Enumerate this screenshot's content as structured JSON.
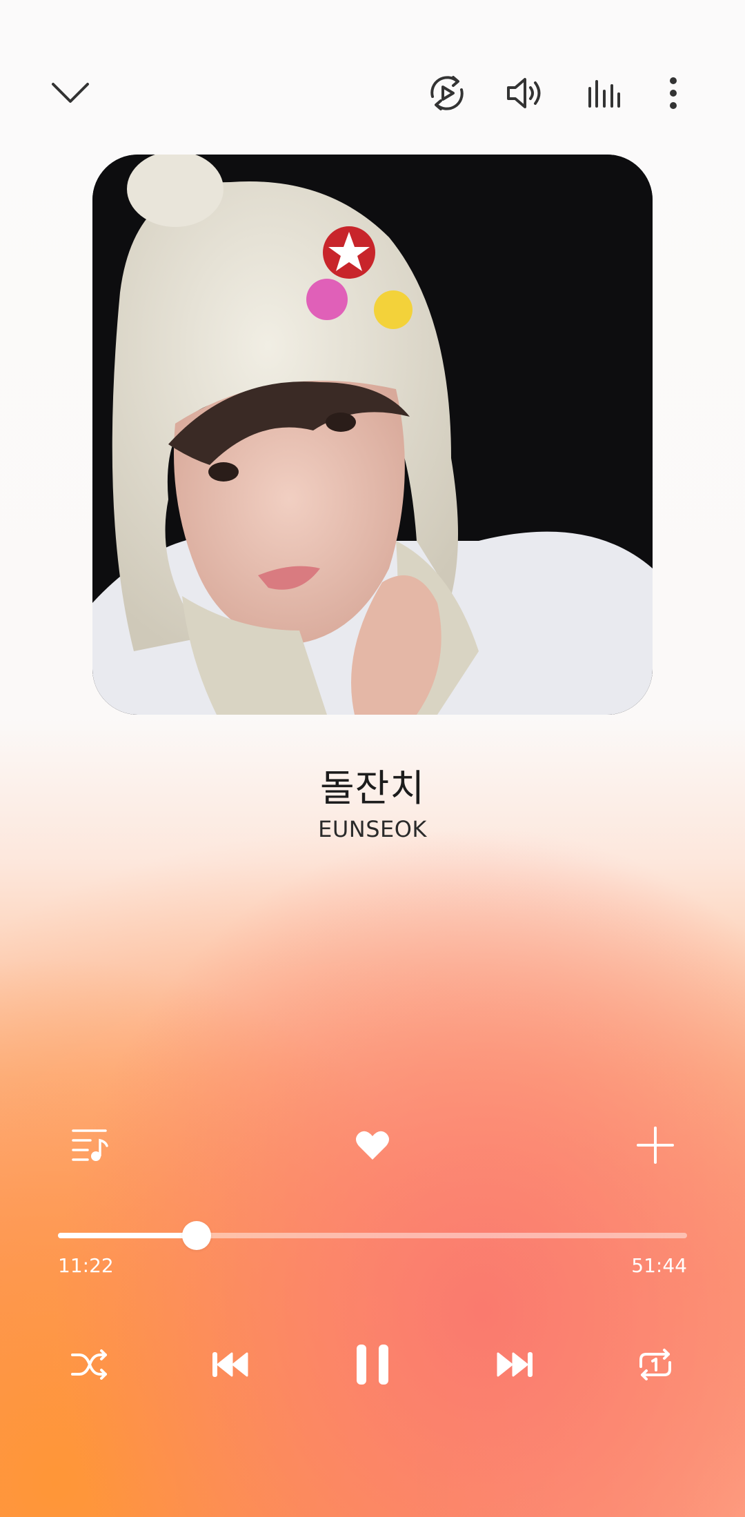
{
  "header": {
    "collapse_icon": "chevron-down-icon",
    "actions": [
      "video-play-icon",
      "volume-icon",
      "equalizer-icon",
      "more-vert-icon"
    ]
  },
  "album_art": {
    "description_icon": "album-art"
  },
  "track": {
    "title": "돌잔치",
    "artist": "EUNSEOK"
  },
  "actions": {
    "queue_icon": "playlist-music-icon",
    "favorite_icon": "heart-icon",
    "add_icon": "plus-icon"
  },
  "progress": {
    "elapsed": "11:22",
    "duration": "51:44",
    "fraction": 0.22
  },
  "controls": [
    "shuffle-icon",
    "previous-icon",
    "pause-icon",
    "next-icon",
    "repeat-one-icon"
  ],
  "colors": {
    "accent_orange": "#fb9a55",
    "accent_coral": "#fa8474"
  }
}
